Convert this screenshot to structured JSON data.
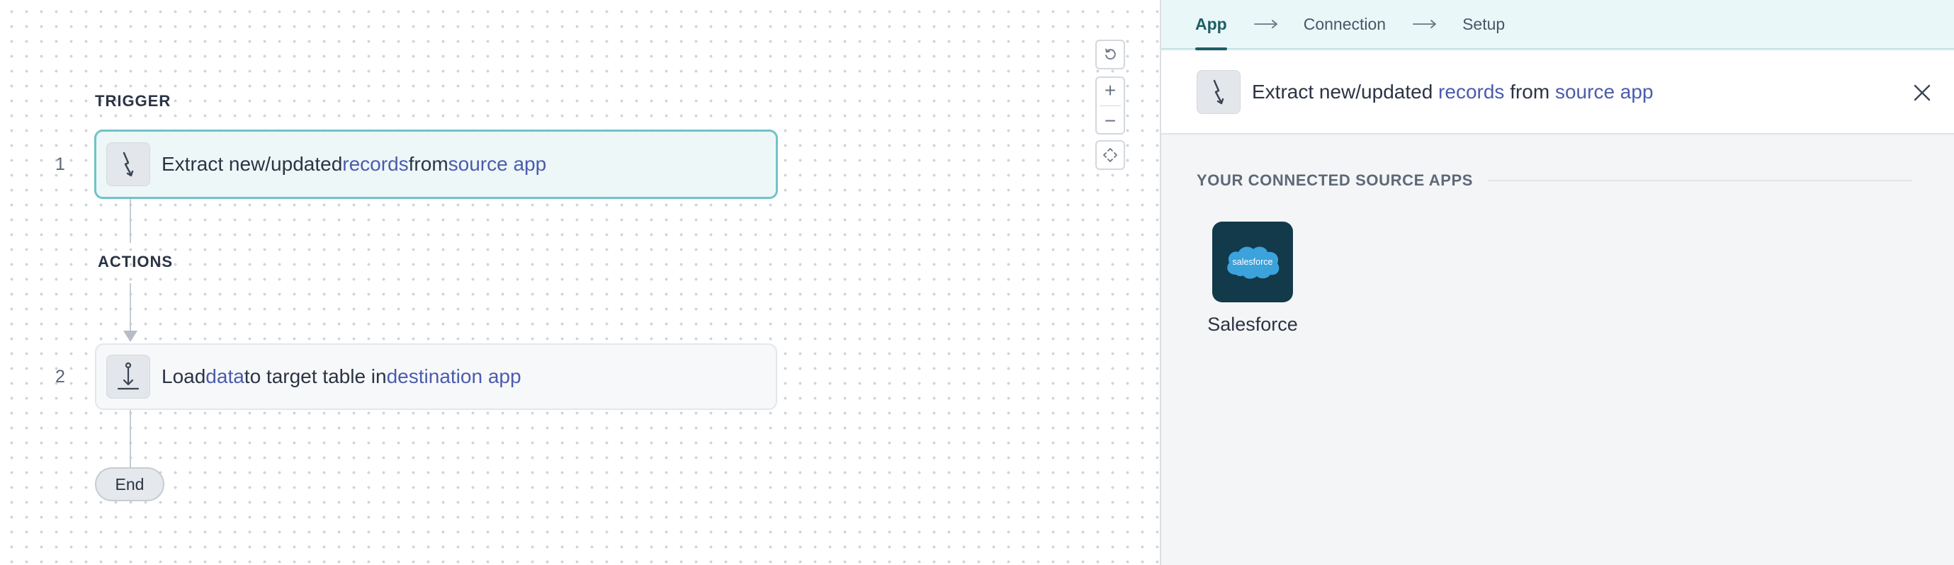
{
  "canvas": {
    "trigger_label": "TRIGGER",
    "actions_label": "ACTIONS",
    "end_label": "End",
    "steps": [
      {
        "number": "1",
        "icon": "trigger-icon",
        "parts": [
          "Extract new/updated ",
          "records",
          " from ",
          "source app"
        ]
      },
      {
        "number": "2",
        "icon": "download-icon",
        "parts": [
          "Load ",
          "data",
          " to target table in ",
          "destination app"
        ]
      }
    ],
    "zoom_controls": {
      "reset": "reset-icon",
      "zoom_in": "+",
      "zoom_out": "−",
      "fit": "fit-icon"
    }
  },
  "panel": {
    "tabs": [
      {
        "label": "App",
        "active": true
      },
      {
        "label": "Connection",
        "active": false
      },
      {
        "label": "Setup",
        "active": false
      }
    ],
    "header": {
      "parts": [
        "Extract new/updated ",
        "records",
        " from ",
        "source app"
      ]
    },
    "group_heading": "YOUR CONNECTED SOURCE APPS",
    "apps": [
      {
        "name": "Salesforce",
        "logo_text": "salesforce"
      }
    ]
  },
  "colors": {
    "accent_teal": "#6fc3c8",
    "token_blue": "#4b5cad",
    "salesforce_bg": "#123a4b",
    "salesforce_cloud": "#3ba2dc"
  }
}
